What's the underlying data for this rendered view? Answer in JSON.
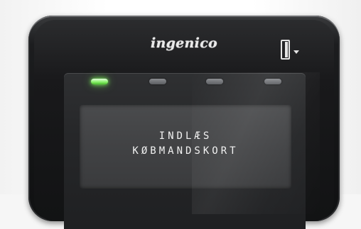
{
  "terminal": {
    "brand": "ingenico",
    "slot_icon": "card-slot-icon",
    "leds": [
      {
        "name": "led-1",
        "state": "on",
        "color": "#7cf25a"
      },
      {
        "name": "led-2",
        "state": "off"
      },
      {
        "name": "led-3",
        "state": "off"
      },
      {
        "name": "led-4",
        "state": "off"
      }
    ]
  },
  "display": {
    "line1": "INDLÆS",
    "line2": "KØBMANDSKORT"
  }
}
